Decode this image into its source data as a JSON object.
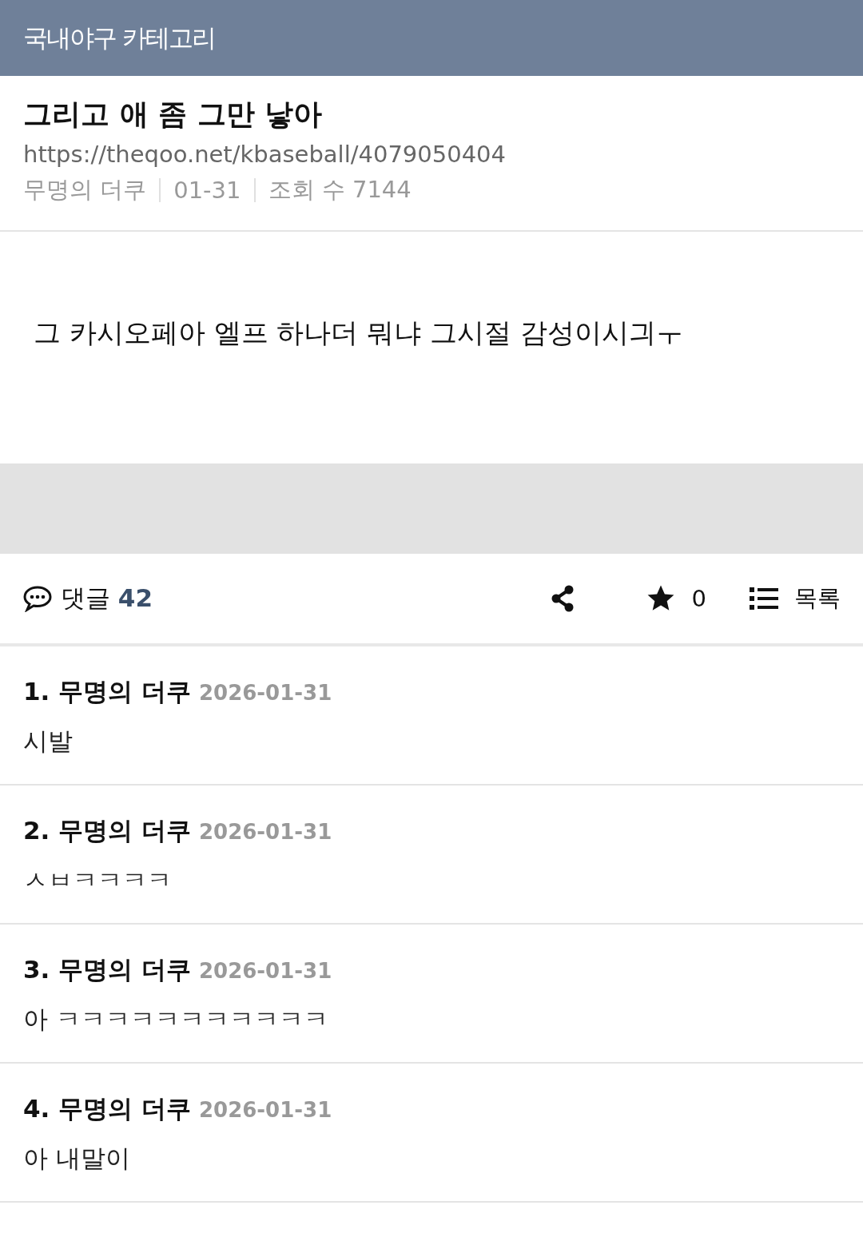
{
  "header": {
    "title": "국내야구 카테고리"
  },
  "post": {
    "title": "그리고 애 좀 그만 낳아",
    "url": "https://theqoo.net/kbaseball/4079050404",
    "meta": [
      "무명의 더쿠",
      "01-31",
      "조회 수 7144"
    ],
    "body": "그 카시오페아 엘프 하나더 뭐냐 그시절 감성이시긔ㅜ"
  },
  "actions": {
    "comments_label": "댓글",
    "comments_count": "42",
    "stars": "0",
    "list_label": "목록"
  },
  "comments": [
    {
      "number": "1.",
      "author": "무명의 더쿠",
      "date": "2026-01-31",
      "text": "시발"
    },
    {
      "number": "2.",
      "author": "무명의 더쿠",
      "date": "2026-01-31",
      "text": "ㅅㅂㅋㅋㅋㅋ"
    },
    {
      "number": "3.",
      "author": "무명의 더쿠",
      "date": "2026-01-31",
      "text": "아 ㅋㅋㅋㅋㅋㅋㅋㅋㅋㅋㅋ"
    },
    {
      "number": "4.",
      "author": "무명의 더쿠",
      "date": "2026-01-31",
      "text": "아 내말이"
    }
  ]
}
